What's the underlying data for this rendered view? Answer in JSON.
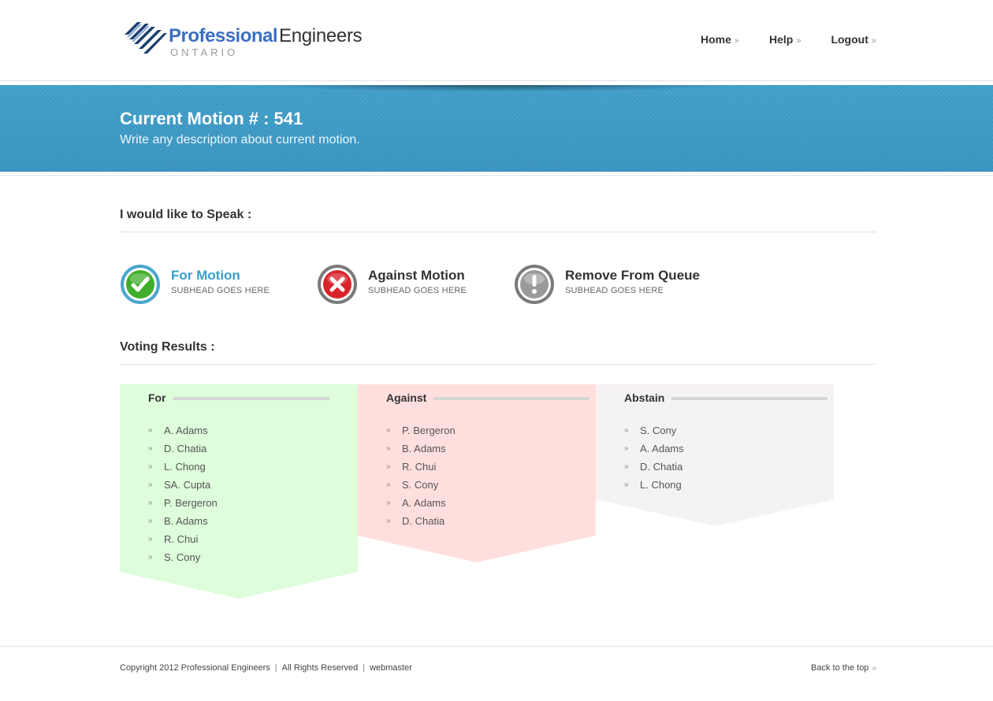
{
  "logo": {
    "word1": "Professional",
    "word2": "Engineers",
    "sub": "ONTARIO"
  },
  "nav": {
    "items": [
      {
        "label": "Home"
      },
      {
        "label": "Help"
      },
      {
        "label": "Logout"
      }
    ],
    "arrow": "»"
  },
  "banner": {
    "title": "Current Motion # : 541",
    "description": "Write any description about current motion."
  },
  "speak": {
    "heading": "I would like to Speak :",
    "options": [
      {
        "title": "For Motion",
        "subhead": "SUBHEAD GOES HERE",
        "icon": "check-circle-icon",
        "color": "#3a9dc9"
      },
      {
        "title": "Against Motion",
        "subhead": "SUBHEAD GOES HERE",
        "icon": "x-circle-icon",
        "color": "#d9232a"
      },
      {
        "title": "Remove From Queue",
        "subhead": "SUBHEAD GOES HERE",
        "icon": "exclamation-circle-icon",
        "color": "#8a8a8a"
      }
    ]
  },
  "voting": {
    "heading": "Voting Results :",
    "columns": [
      {
        "title": "For",
        "color": "#ddfddb",
        "names": [
          "A. Adams",
          "D. Chatia",
          "L. Chong",
          "SA. Cupta",
          "P. Bergeron",
          "B. Adams",
          "R. Chui",
          "S. Cony"
        ]
      },
      {
        "title": "Against",
        "color": "#ffdfdd",
        "names": [
          "P. Bergeron",
          "B. Adams",
          "R. Chui",
          "S. Cony",
          "A. Adams",
          "D. Chatia"
        ]
      },
      {
        "title": "Abstain",
        "color": "#f5f2f2",
        "names": [
          "S. Cony",
          "A. Adams",
          "D. Chatia",
          "L. Chong"
        ]
      }
    ],
    "bullet": "»"
  },
  "footer": {
    "copyright": "Copyright 2012 Professional Engineers",
    "rights": "All Rights Reserved",
    "webmaster": "webmaster",
    "separator": "|",
    "back_to_top": "Back to the top",
    "arrow": "»"
  }
}
